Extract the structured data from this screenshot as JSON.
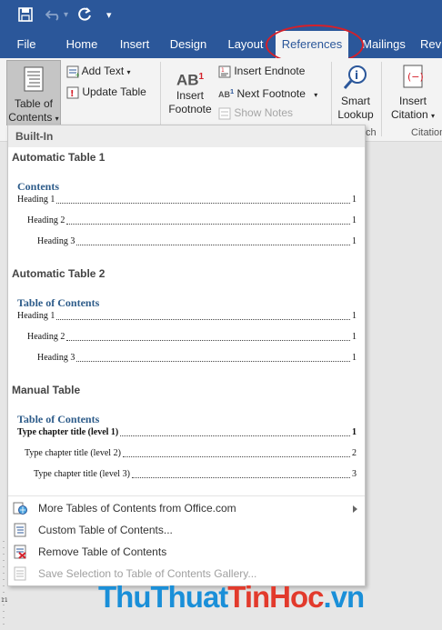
{
  "titlebar": {
    "save_icon": "save-icon",
    "undo_icon": "undo-icon",
    "redo_icon": "redo-icon",
    "customize_icon": "customize-qat-icon"
  },
  "tabs": [
    {
      "label": "File"
    },
    {
      "label": "Home"
    },
    {
      "label": "Insert"
    },
    {
      "label": "Design"
    },
    {
      "label": "Layout"
    },
    {
      "label": "References"
    },
    {
      "label": "Mailings"
    },
    {
      "label": "Rev"
    }
  ],
  "ribbon": {
    "toc_label_1": "Table of",
    "toc_label_2": "Contents",
    "add_text": "Add Text",
    "update_table": "Update Table",
    "insert_footnote_1": "Insert",
    "insert_footnote_2": "Footnote",
    "footnote_icon_text": "AB",
    "footnote_sup": "1",
    "insert_endnote": "Insert Endnote",
    "next_footnote": "Next Footnote",
    "show_notes": "Show Notes",
    "smart_lookup_1": "Smart",
    "smart_lookup_2": "Lookup",
    "insert_citation_1": "Insert",
    "insert_citation_2": "Citation",
    "group_research": "ch",
    "group_citations": "Citation"
  },
  "dropdown": {
    "header": "Built-In",
    "gallery": [
      {
        "title": "Automatic Table 1",
        "heading": "Contents",
        "lines": [
          {
            "text": "Heading 1",
            "page": "1"
          },
          {
            "text": "Heading 2",
            "page": "1"
          },
          {
            "text": "Heading 3",
            "page": "1"
          }
        ]
      },
      {
        "title": "Automatic Table 2",
        "heading": "Table of Contents",
        "lines": [
          {
            "text": "Heading 1",
            "page": "1"
          },
          {
            "text": "Heading 2",
            "page": "1"
          },
          {
            "text": "Heading 3",
            "page": "1"
          }
        ]
      },
      {
        "title": "Manual Table",
        "heading": "Table of Contents",
        "lines": [
          {
            "text": "Type chapter title (level 1)",
            "page": "1"
          },
          {
            "text": "Type chapter title (level 2)",
            "page": "2"
          },
          {
            "text": "Type chapter title (level 3)",
            "page": "3"
          }
        ]
      }
    ],
    "menu": [
      {
        "label": "More Tables of Contents from Office.com",
        "icon": "office-globe-icon"
      },
      {
        "label": "Custom Table of Contents...",
        "icon": "custom-toc-icon"
      },
      {
        "label": "Remove Table of Contents",
        "icon": "remove-toc-icon"
      },
      {
        "label": "Save Selection to Table of Contents Gallery...",
        "icon": "save-gallery-icon"
      }
    ]
  },
  "watermark": {
    "part1": "ThuThuat",
    "part2": "TinHoc",
    "part3": ".vn"
  },
  "colors": {
    "ribbon_blue": "#2b579a",
    "toc_heading": "#2e5c8a",
    "highlight_circle": "#d4202a"
  }
}
